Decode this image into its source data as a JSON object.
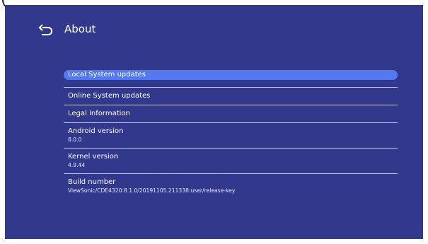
{
  "corner_text": "(",
  "header": {
    "title": "About",
    "back_icon": "back-arrow-icon"
  },
  "menu": {
    "items": [
      {
        "label": "Local System updates"
      },
      {
        "label": "Online System updates"
      },
      {
        "label": "Legal Information"
      },
      {
        "label": "Android version",
        "value": "8.0.0"
      },
      {
        "label": "Kernel version",
        "value": "4.9.44"
      },
      {
        "label": "Build number",
        "value": "ViewSonic/CDE4320:8.1.0/20191105.211338:user/release-key"
      }
    ]
  },
  "colors": {
    "background": "#32388c",
    "selected": "#5478f0",
    "divider": "#c9cbe6"
  }
}
